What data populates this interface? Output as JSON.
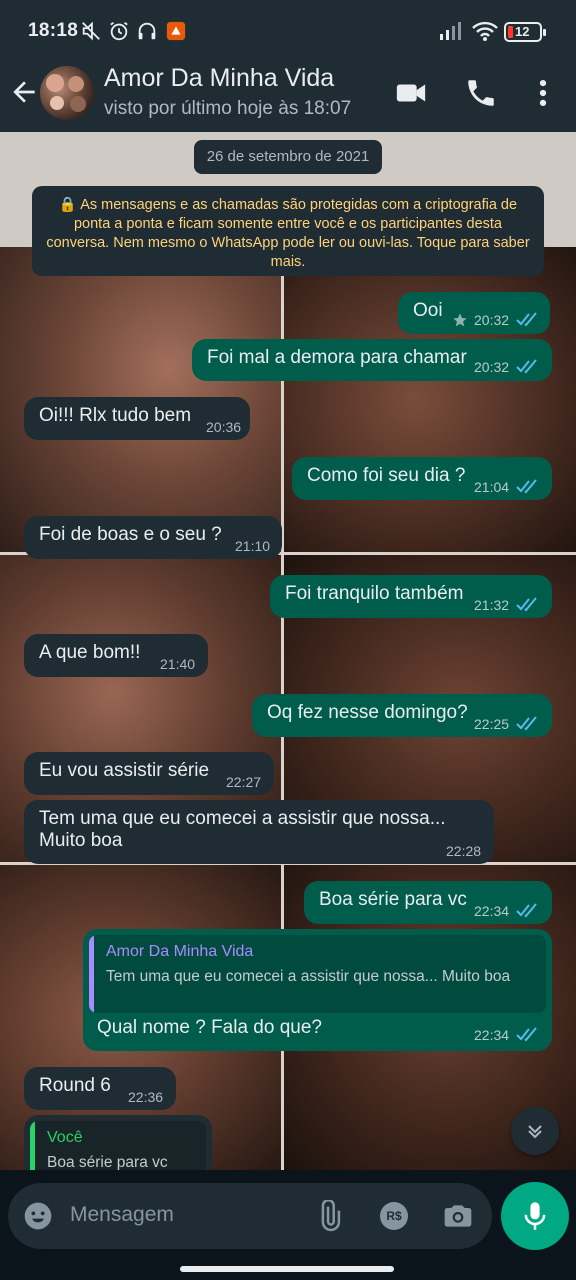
{
  "status_bar": {
    "time": "18:18",
    "battery": "12",
    "icons": [
      "mute-icon",
      "alarm-icon",
      "headphones-icon",
      "app-notification-icon",
      "signal-icon",
      "wifi-icon",
      "battery-icon"
    ]
  },
  "header": {
    "contact_name": "Amor Da Minha Vida",
    "last_seen": "visto por último hoje às 18:07",
    "icons": [
      "back-arrow-icon",
      "video-call-icon",
      "voice-call-icon",
      "more-vert-icon"
    ]
  },
  "chat": {
    "date_chip": "26 de setembro de 2021",
    "encryption_notice": "🔒 As mensagens e as chamadas são protegidas com a criptografia de ponta a ponta e ficam somente entre você e os participantes desta conversa. Nem mesmo o WhatsApp pode ler ou ouvi-las. Toque para saber mais.",
    "messages": [
      {
        "dir": "out",
        "text": "Ooi",
        "time": "20:32",
        "starred": true,
        "read": true
      },
      {
        "dir": "out",
        "text": "Foi mal a demora para chamar",
        "time": "20:32",
        "read": true
      },
      {
        "dir": "in",
        "text": "Oi!!! Rlx tudo bem",
        "time": "20:36"
      },
      {
        "dir": "out",
        "text": "Como foi seu dia ?",
        "time": "21:04",
        "read": true
      },
      {
        "dir": "in",
        "text": "Foi de boas e o seu ?",
        "time": "21:10"
      },
      {
        "dir": "out",
        "text": "Foi tranquilo também",
        "time": "21:32",
        "read": true
      },
      {
        "dir": "in",
        "text": "A que bom!!",
        "time": "21:40"
      },
      {
        "dir": "out",
        "text": "Oq fez nesse domingo?",
        "time": "22:25",
        "read": true
      },
      {
        "dir": "in",
        "text": "Eu vou assistir série",
        "time": "22:27"
      },
      {
        "dir": "in",
        "text": "Tem uma que eu comecei a assistir que nossa... Muito boa",
        "time": "22:28"
      },
      {
        "dir": "out",
        "text": "Boa série para vc",
        "time": "22:34",
        "read": true
      },
      {
        "dir": "out",
        "text": "Qual nome ? Fala do que?",
        "time": "22:34",
        "read": true,
        "quote": {
          "author": "Amor Da Minha Vida",
          "text": "Tem uma que eu comecei a assistir que nossa... Muito boa"
        }
      },
      {
        "dir": "in",
        "text": "Round 6",
        "time": "22:36"
      },
      {
        "dir": "in",
        "text": "",
        "time": "",
        "quote": {
          "author": "Você",
          "text": "Boa série para vc"
        }
      }
    ]
  },
  "composer": {
    "placeholder": "Mensagem",
    "icons": [
      "emoji-icon",
      "attach-icon",
      "payment-icon",
      "camera-icon",
      "mic-icon"
    ]
  },
  "colors": {
    "header_bg": "#1f2c33",
    "outgoing_bubble": "#005c4b",
    "incoming_bubble": "#1f2c33",
    "read_ticks": "#53bdeb",
    "accent": "#00a884",
    "notice_text": "#ffd279",
    "quote_name_purple": "#a98bff",
    "quote_name_green": "#25d366"
  }
}
